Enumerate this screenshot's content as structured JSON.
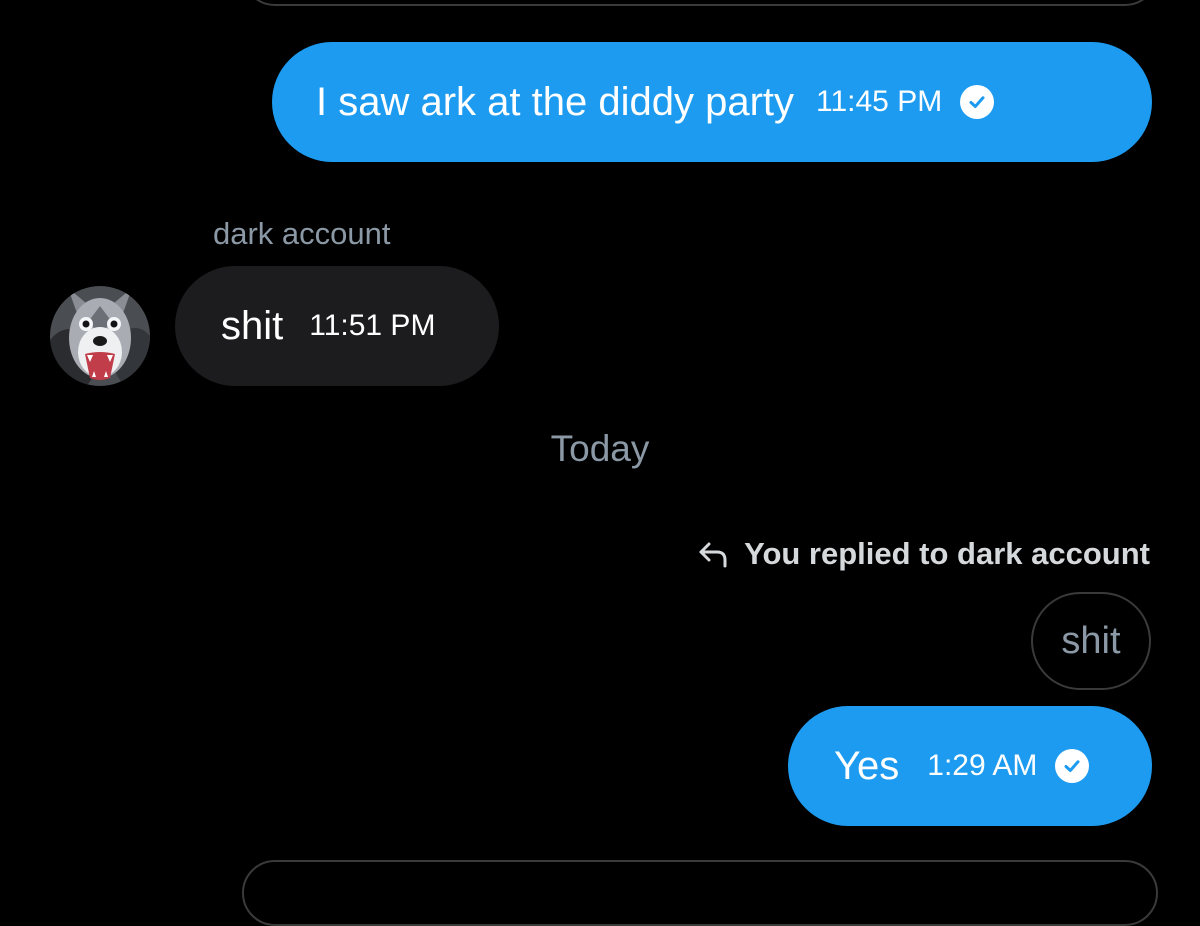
{
  "conversation": {
    "accent_color": "#1d9bf0",
    "messages": [
      {
        "direction": "outgoing",
        "text": "I saw ark at the diddy party",
        "time": "11:45 PM",
        "status_icon": "check-circle-icon"
      },
      {
        "direction": "incoming",
        "sender": "dark account",
        "avatar_icon": "husky-avatar",
        "text": "shit",
        "time": "11:51 PM"
      },
      {
        "direction": "outgoing",
        "reply_note": "You replied to dark account",
        "reply_icon": "reply-arrow-icon",
        "quoted_text": "shit",
        "text": "Yes",
        "time": "1:29 AM",
        "status_icon": "check-circle-icon"
      }
    ],
    "date_separator": "Today"
  }
}
